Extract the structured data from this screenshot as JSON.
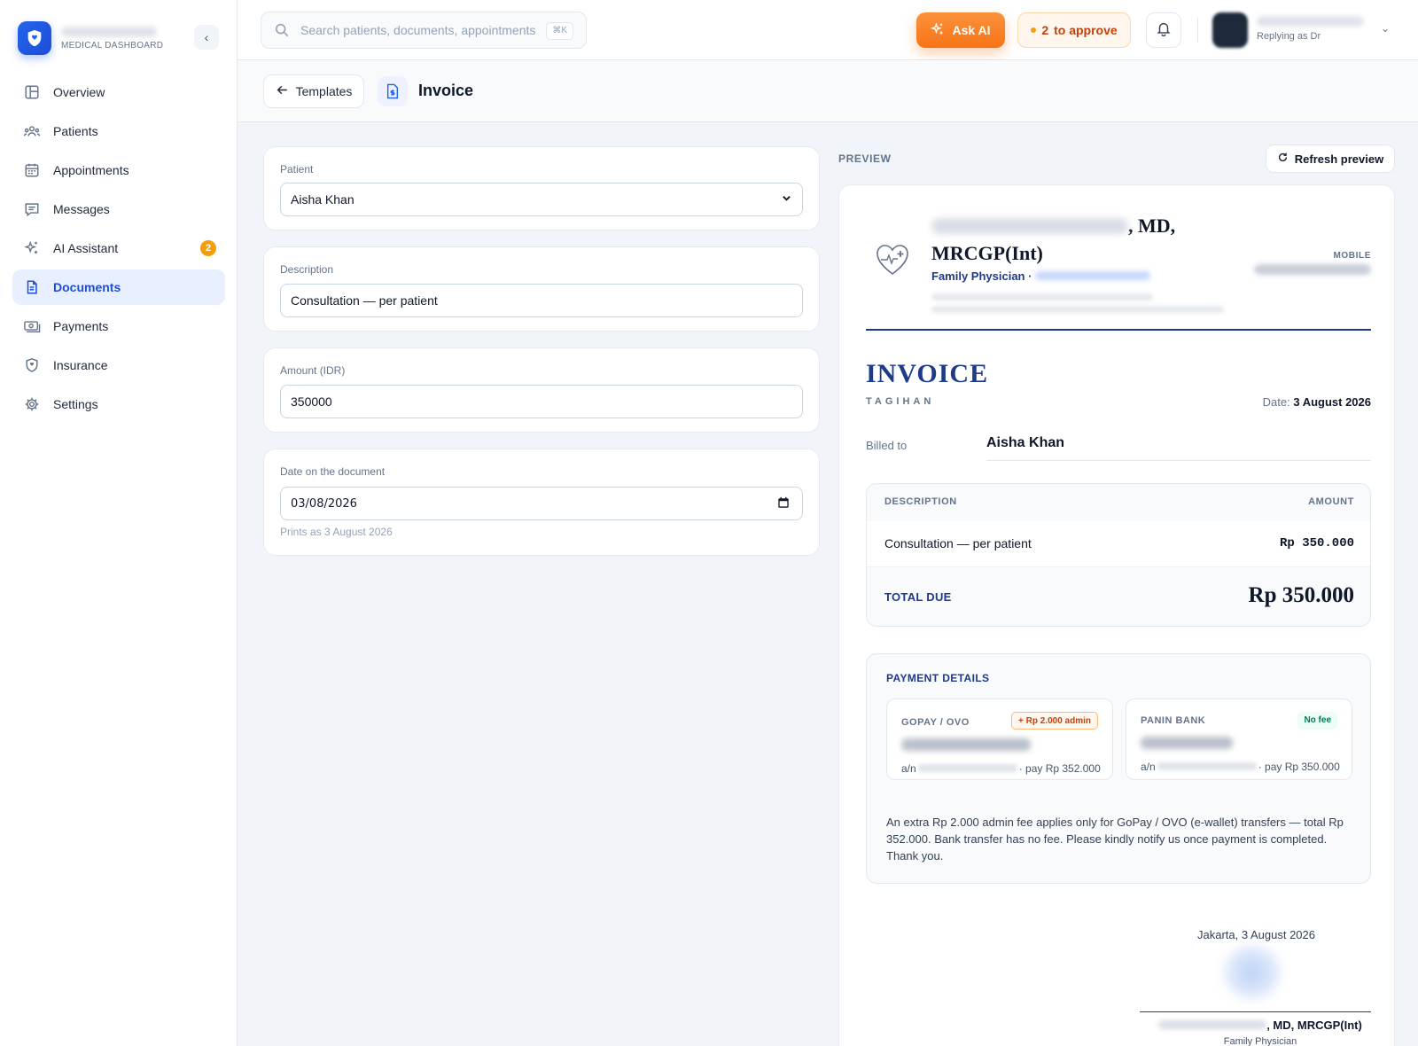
{
  "brand": {
    "subtitle": "MEDICAL DASHBOARD"
  },
  "sidebar": {
    "items": [
      {
        "label": "Overview",
        "icon": "layout-icon"
      },
      {
        "label": "Patients",
        "icon": "users-icon"
      },
      {
        "label": "Appointments",
        "icon": "calendar-icon"
      },
      {
        "label": "Messages",
        "icon": "message-icon"
      },
      {
        "label": "AI Assistant",
        "icon": "sparkle-icon",
        "badge": "2"
      },
      {
        "label": "Documents",
        "icon": "document-icon",
        "active": true
      },
      {
        "label": "Payments",
        "icon": "cash-icon"
      },
      {
        "label": "Insurance",
        "icon": "shield-icon"
      },
      {
        "label": "Settings",
        "icon": "gear-icon"
      }
    ]
  },
  "topbar": {
    "search_placeholder": "Search patients, documents, appointments",
    "shortcut": "⌘K",
    "ask_ai": "Ask AI",
    "approve_count": "2",
    "approve_label": "to approve",
    "user_sub": "Replying as Dr"
  },
  "page": {
    "back_label": "Templates",
    "title": "Invoice"
  },
  "form": {
    "patient": {
      "label": "Patient",
      "value": "Aisha Khan"
    },
    "description": {
      "label": "Description",
      "value": "Consultation — per patient"
    },
    "amount": {
      "label": "Amount (IDR)",
      "value": "350000"
    },
    "date": {
      "label": "Date on the document",
      "value": "03/08/2026",
      "hint": "Prints as 3 August 2026"
    }
  },
  "preview": {
    "label": "PREVIEW",
    "refresh": "Refresh preview",
    "doctor_suffix": ", MD,",
    "doctor_line2": "MRCGP(Int)",
    "role": "Family Physician ·",
    "mobile_label": "MOBILE",
    "doc_title": "INVOICE",
    "doc_subtitle": "TAGIHAN",
    "date_label": "Date:",
    "date_value": "3 August 2026",
    "billed_label": "Billed to",
    "billed_name": "Aisha Khan",
    "table": {
      "col_desc": "DESCRIPTION",
      "col_amount": "AMOUNT",
      "row_desc": "Consultation — per patient",
      "row_amount": "Rp 350.000",
      "total_label": "TOTAL DUE",
      "total_value": "Rp 350.000"
    },
    "payment": {
      "title": "PAYMENT DETAILS",
      "methods": [
        {
          "name": "GOPAY / OVO",
          "badge": "+ Rp 2.000 admin",
          "an_prefix": "a/n",
          "pay_text": "· pay Rp 352.000"
        },
        {
          "name": "PANIN BANK",
          "badge": "No fee",
          "an_prefix": "a/n",
          "pay_text": "· pay Rp 350.000"
        }
      ],
      "note": "An extra Rp 2.000 admin fee applies only for GoPay / OVO (e-wallet) transfers — total Rp 352.000. Bank transfer has no fee. Please kindly notify us once payment is completed. Thank you."
    },
    "place_date": "Jakarta, 3 August 2026",
    "sign_suffix": ", MD, MRCGP(Int)",
    "sign_role": "Family Physician"
  },
  "colors": {
    "accent": "#1d4ed8",
    "navy": "#1e3a8a",
    "orange": "#f97316"
  }
}
